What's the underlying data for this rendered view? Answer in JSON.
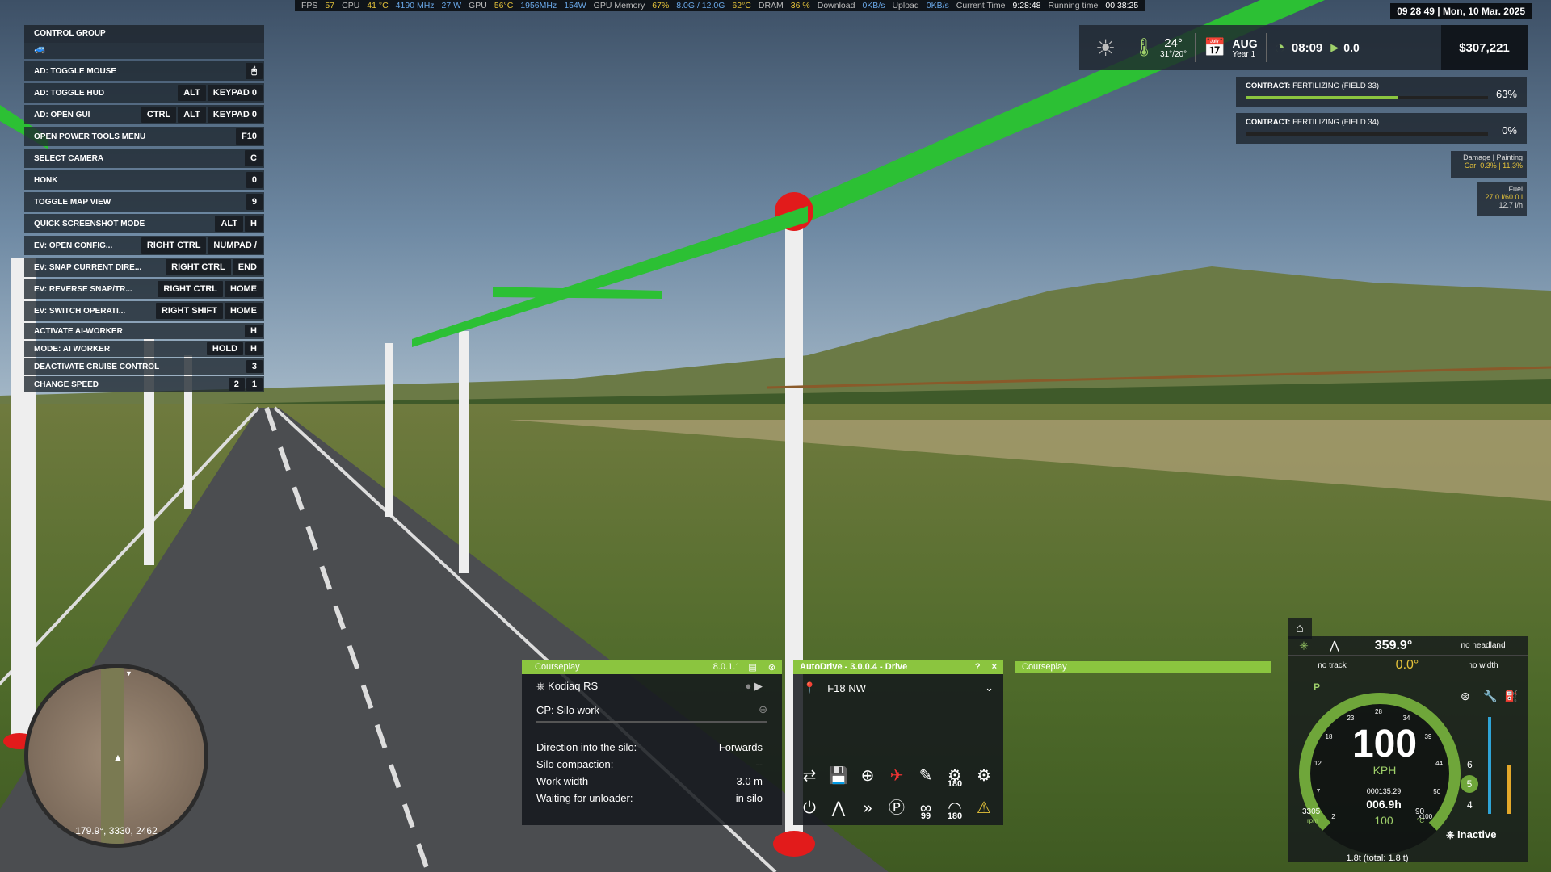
{
  "perf_bar": {
    "fps_label": "FPS",
    "fps": "57",
    "cpu_label": "CPU",
    "cpu_temp": "41 °C",
    "cpu_freq": "4190 MHz",
    "cpu_power": "27 W",
    "gpu_label": "GPU",
    "gpu_temp": "56°C",
    "gpu_freq": "1956MHz",
    "gpu_power": "154W",
    "gpu_mem_label": "GPU Memory",
    "gpu_mem_pct": "67%",
    "gpu_mem": "8.0G / 12.0G",
    "gpu_mem_temp": "62°C",
    "dram_label": "DRAM",
    "dram": "36 %",
    "download_label": "Download",
    "download": "0KB/s",
    "upload_label": "Upload",
    "upload": "0KB/s",
    "time_label": "Current Time",
    "time": "9:28:48",
    "running_label": "Running time",
    "running": "00:38:25"
  },
  "datetime": "09 28 49 | Mon, 10 Mar. 2025",
  "control_group": {
    "title": "CONTROL GROUP",
    "rows": [
      {
        "label": "AD: TOGGLE MOUSE",
        "keys": [
          "🖱"
        ]
      },
      {
        "label": "AD: TOGGLE HUD",
        "keys": [
          "ALT",
          "KEYPAD 0"
        ]
      },
      {
        "label": "AD: OPEN GUI",
        "keys": [
          "CTRL",
          "ALT",
          "KEYPAD 0"
        ]
      },
      {
        "label": "OPEN POWER TOOLS MENU",
        "keys": [
          "F10"
        ]
      },
      {
        "label": "SELECT CAMERA",
        "keys": [
          "C"
        ]
      },
      {
        "label": "HONK",
        "keys": [
          "0"
        ]
      },
      {
        "label": "TOGGLE MAP VIEW",
        "keys": [
          "9"
        ]
      },
      {
        "label": "QUICK SCREENSHOT MODE",
        "keys": [
          "ALT",
          "H"
        ]
      },
      {
        "label": "EV: OPEN CONFIG...",
        "keys": [
          "RIGHT CTRL",
          "NUMPAD /"
        ]
      },
      {
        "label": "EV: SNAP CURRENT DIRE...",
        "keys": [
          "RIGHT CTRL",
          "END"
        ]
      },
      {
        "label": "EV: REVERSE SNAP/TR...",
        "keys": [
          "RIGHT CTRL",
          "HOME"
        ]
      },
      {
        "label": "EV: SWITCH OPERATI...",
        "keys": [
          "RIGHT SHIFT",
          "HOME"
        ]
      }
    ],
    "small_rows": [
      {
        "label": "ACTIVATE AI-WORKER",
        "keys": [
          "H"
        ]
      },
      {
        "label": "MODE: AI WORKER",
        "keys": [
          "HOLD",
          "H"
        ]
      },
      {
        "label": "DEACTIVATE CRUISE CONTROL",
        "keys": [
          "3"
        ]
      },
      {
        "label": "CHANGE SPEED",
        "keys": [
          "2",
          "1"
        ]
      }
    ]
  },
  "weather": {
    "temp": "24°",
    "range": "31°/20°",
    "month": "AUG",
    "year": "Year 1",
    "time": "08:09",
    "speed": "0.0",
    "money": "$307,221"
  },
  "contracts": [
    {
      "prefix": "CONTRACT:",
      "name": "FERTILIZING (FIELD 33)",
      "progress": 63,
      "pct": "63%"
    },
    {
      "prefix": "CONTRACT:",
      "name": "FERTILIZING (FIELD 34)",
      "progress": 0,
      "pct": "0%"
    }
  ],
  "damage": {
    "title": "Damage | Painting",
    "value": "Car: 0.3% | 11.3%"
  },
  "fuel": {
    "title": "Fuel",
    "level": "27.0 l/60.0 l",
    "rate": "12.7 l/h"
  },
  "minimap": {
    "coords": "179.9°, 3330, 2462"
  },
  "courseplay": {
    "title": "Courseplay",
    "version": "8.0.1.1",
    "vehicle": "Kodiaq RS",
    "job": "CP: Silo work",
    "rows": [
      {
        "label": "Direction into the silo:",
        "value": "Forwards"
      },
      {
        "label": "Silo compaction:",
        "value": "--"
      },
      {
        "label": "Work width",
        "value": "3.0 m"
      },
      {
        "label": "Waiting for unloader:",
        "value": "in silo"
      }
    ]
  },
  "autodrive": {
    "title": "AutoDrive - 3.0.0.4 - Drive",
    "help": "?",
    "close": "×",
    "target": "F18 NW",
    "badge_180a": "180",
    "badge_99": "99",
    "badge_180b": "180"
  },
  "courseplay2": {
    "title": "Courseplay"
  },
  "vehicle_hud": {
    "heading": "359.9°",
    "heading_sub": "0.0°",
    "headland": "no headland",
    "track": "no track",
    "width": "no width",
    "speed": "100",
    "unit": "KPH",
    "odo": "000135.29",
    "hours": "006.9h",
    "cruise": "100",
    "rpm": "3305",
    "rpm_label": "rpm",
    "temp": "90",
    "temp_label": "°C",
    "gear_hi": "6",
    "gear": "5",
    "gear_lo": "4",
    "status": "Inactive",
    "total": "1.8t (total: 1.8 t)",
    "gauge_ticks": [
      "2",
      "7",
      "12",
      "18",
      "23",
      "28",
      "34",
      "39",
      "44",
      "50",
      "x100"
    ]
  }
}
